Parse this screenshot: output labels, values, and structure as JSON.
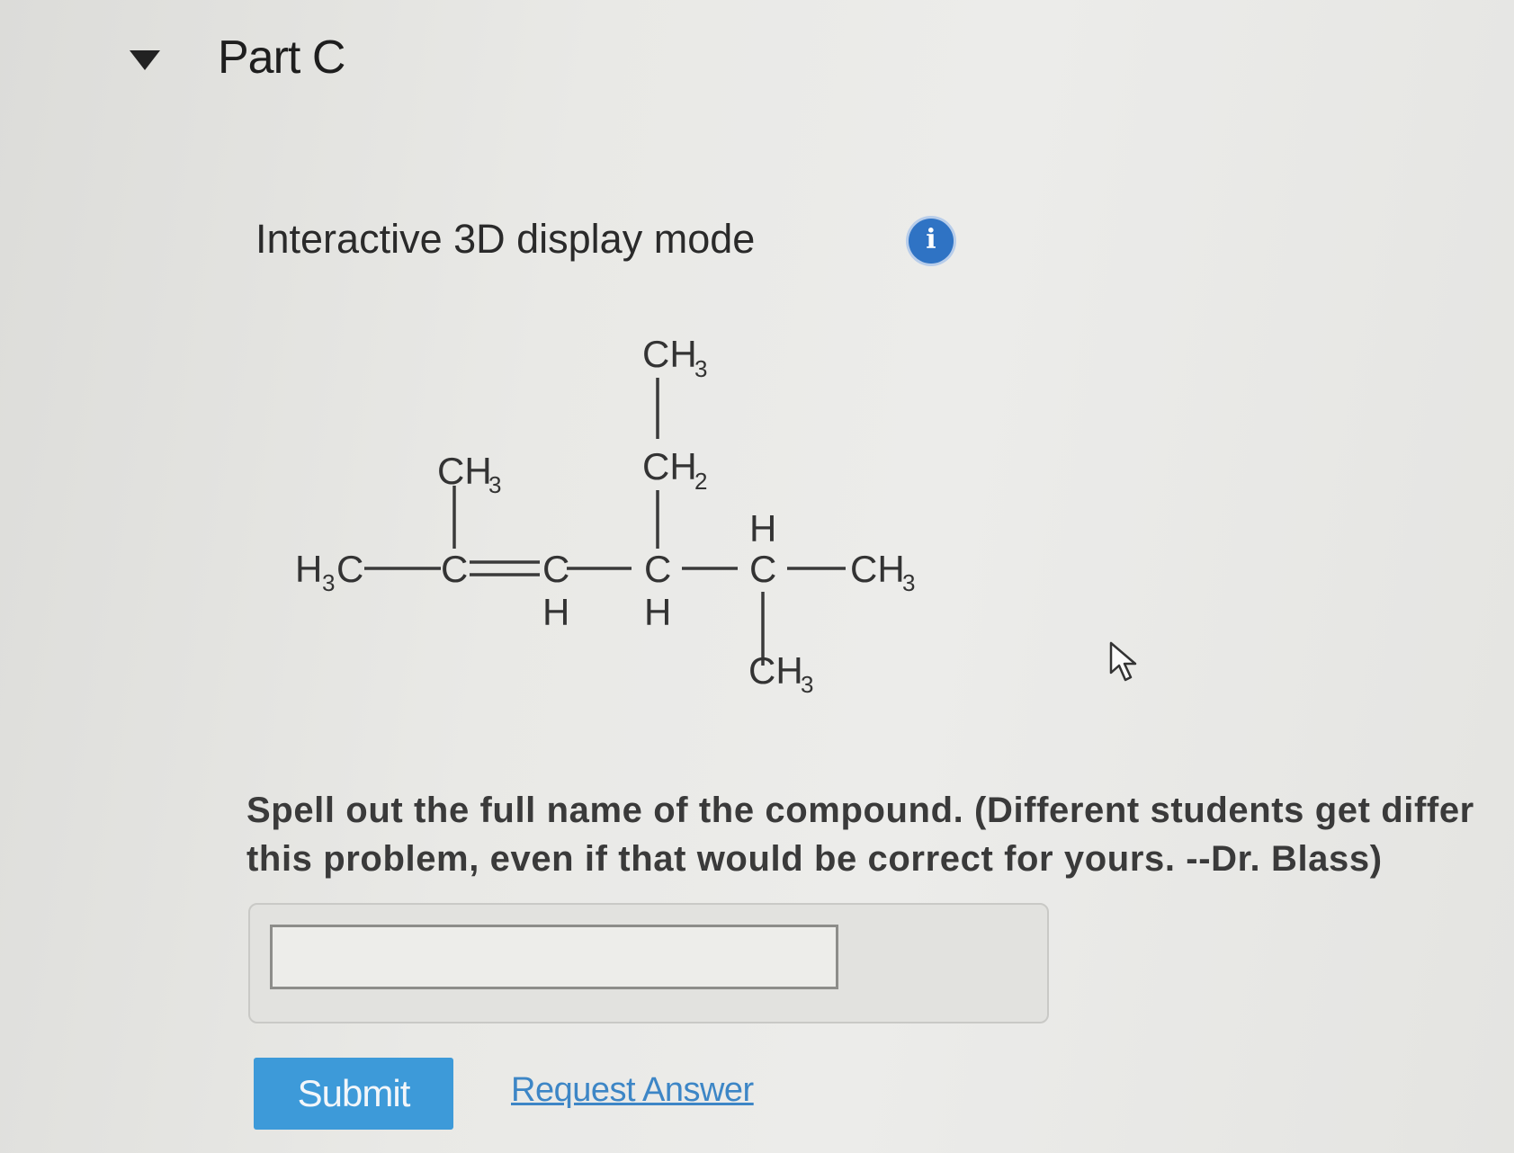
{
  "part": {
    "title": "Part C"
  },
  "display_mode": {
    "label": "Interactive 3D display mode",
    "info_icon": "info-icon",
    "info_glyph": "i"
  },
  "structure": {
    "atoms": {
      "h3c_left": "H",
      "h3c_left_sub": "3",
      "h3c_left_c": "C",
      "c2": "C",
      "c2_methyl": "CH",
      "c2_methyl_sub": "3",
      "c3": "C",
      "c3_h": "H",
      "c4": "C",
      "c4_h": "H",
      "ethyl_ch2": "CH",
      "ethyl_ch2_sub": "2",
      "ethyl_ch3": "CH",
      "ethyl_ch3_sub": "3",
      "c5": "C",
      "c5_h": "H",
      "c5_methyl": "CH",
      "c5_methyl_sub": "3",
      "c6": "CH",
      "c6_sub": "3"
    }
  },
  "question": {
    "prompt": "Spell out the full name of the compound. (Different students get differ",
    "prompt_line2": "this problem, even if that would be correct for yours. --Dr. Blass)"
  },
  "answer": {
    "value": "",
    "placeholder": ""
  },
  "actions": {
    "submit_label": "Submit",
    "request_answer_label": "Request Answer"
  },
  "colors": {
    "accent": "#3d9ad9",
    "link": "#3d86c6",
    "info": "#2f73c4"
  }
}
